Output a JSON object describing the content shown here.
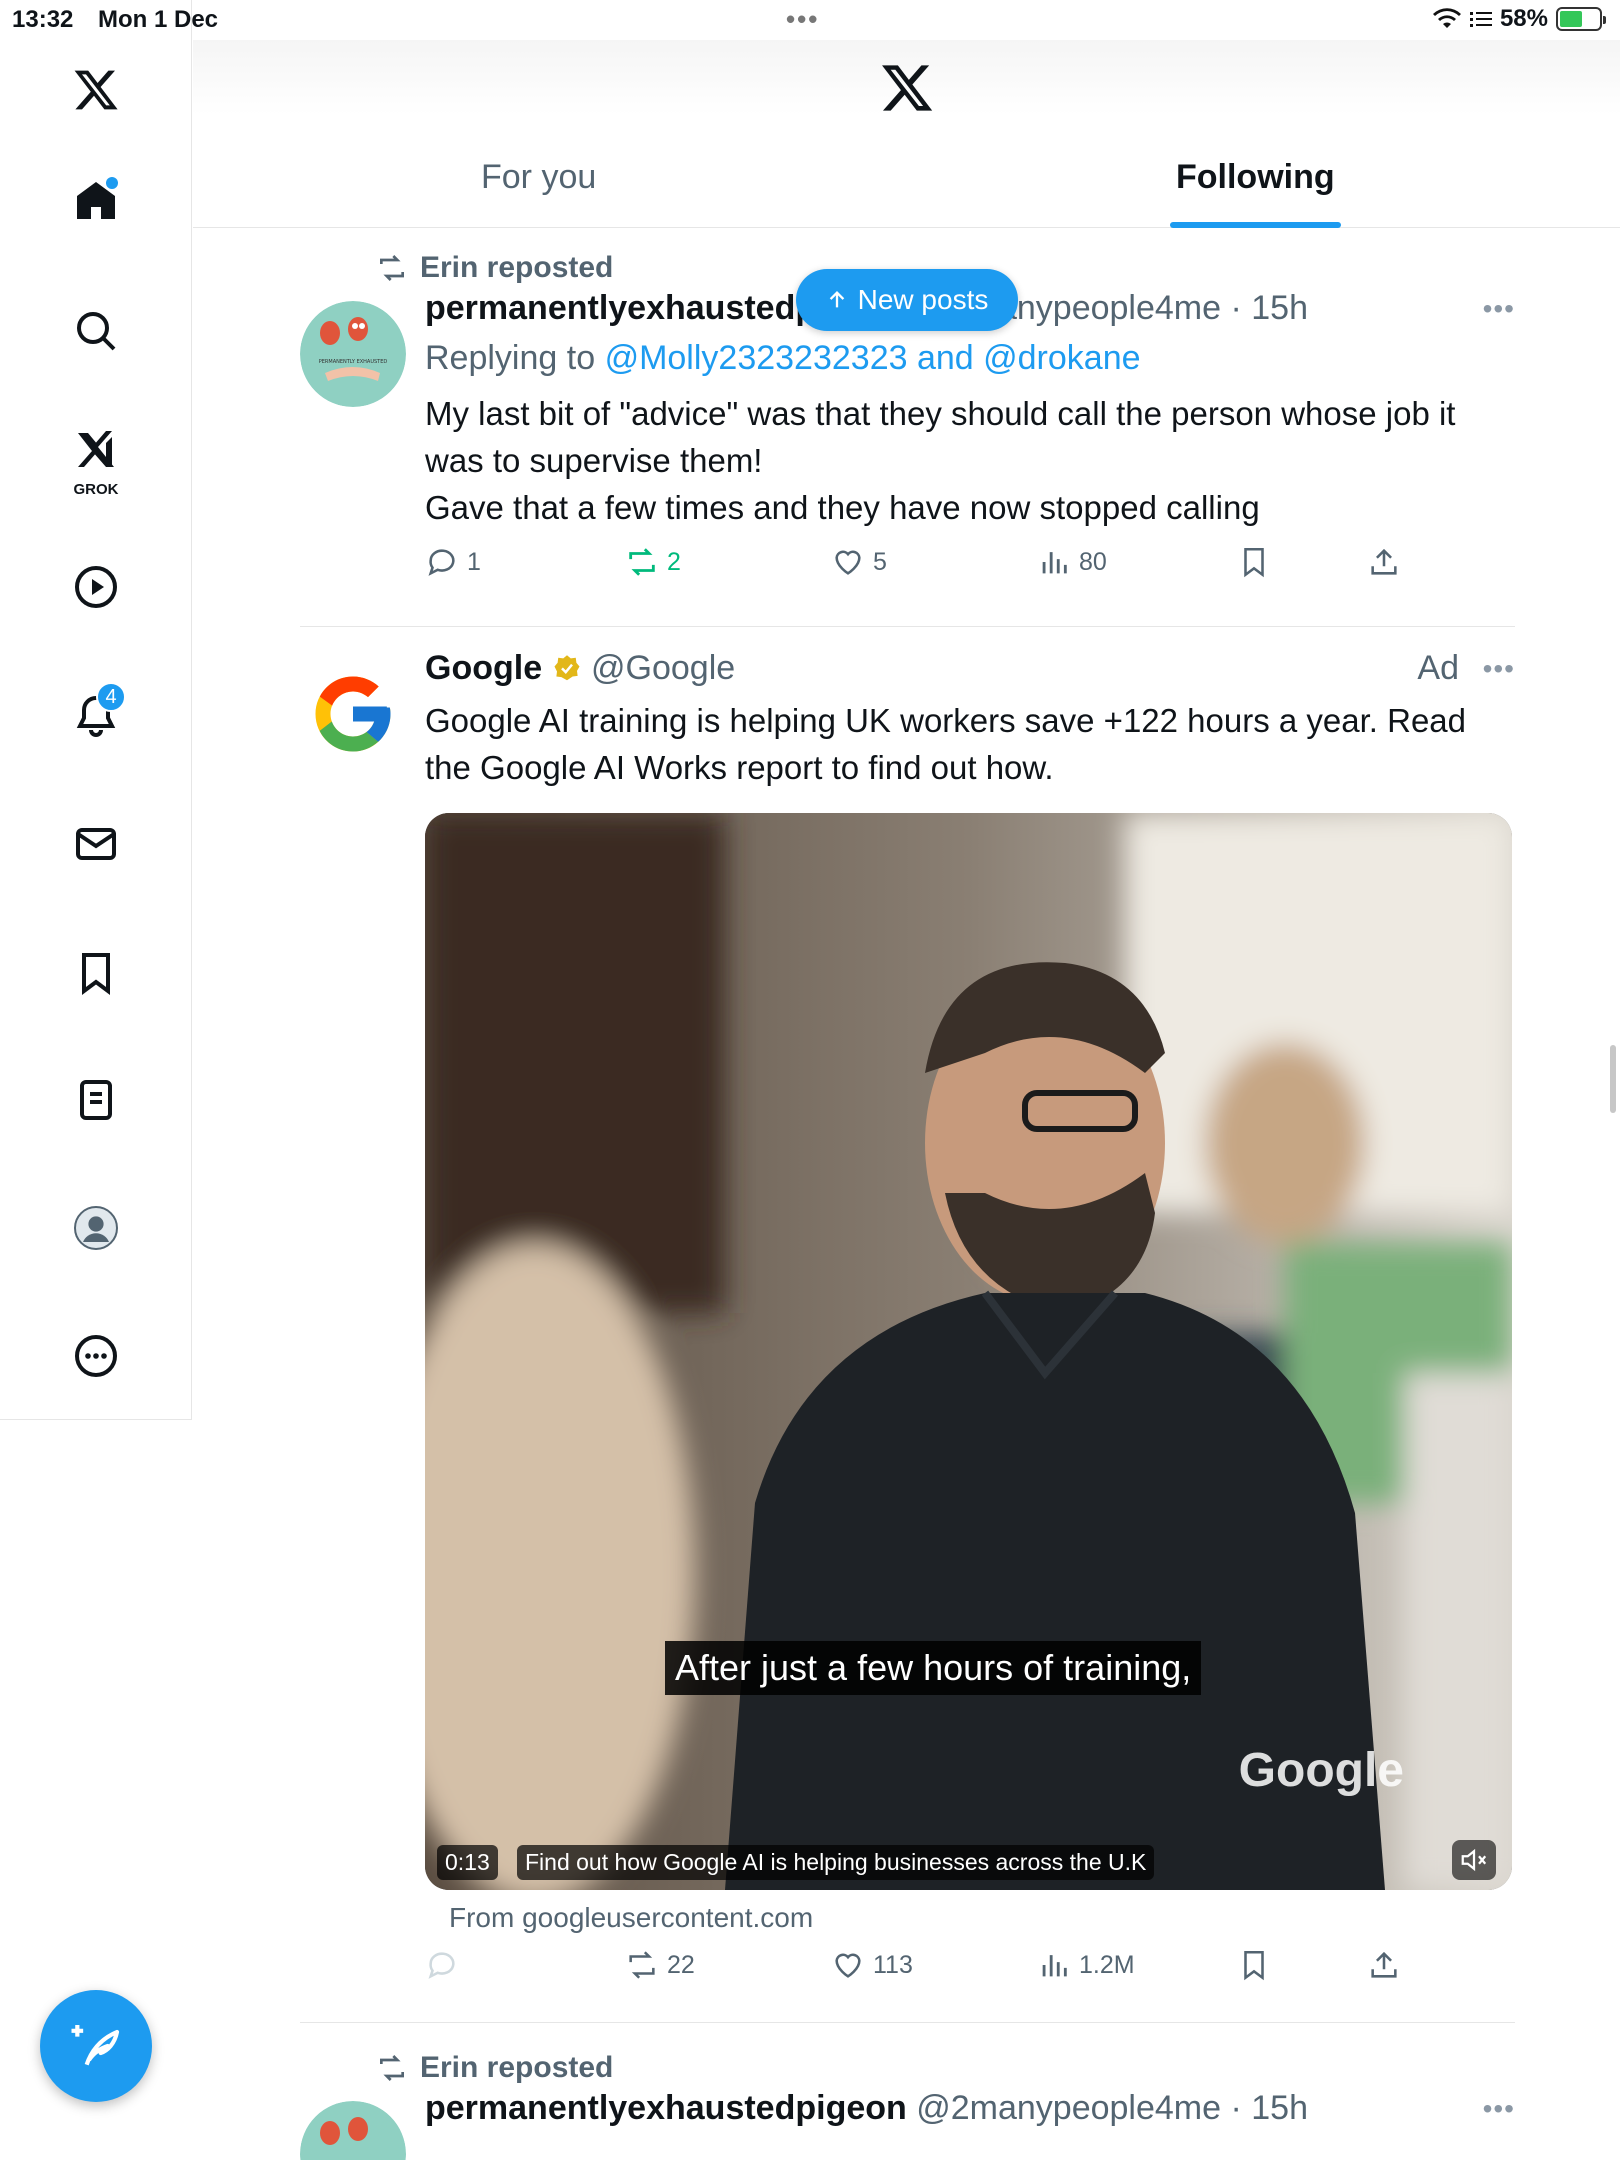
{
  "status_bar": {
    "time": "13:32",
    "date": "Mon 1 Dec",
    "battery": "58%"
  },
  "sidebar": {
    "grok_label": "GROK",
    "notifications_count": "4"
  },
  "header": {
    "tabs": [
      {
        "label": "For you",
        "selected": false
      },
      {
        "label": "Following",
        "selected": true
      }
    ]
  },
  "new_posts_label": "New posts",
  "posts": [
    {
      "repost_by": "Erin reposted",
      "display_name": "permanentlyexhaustedpigeon",
      "handle": "@2manypeople4me",
      "time": "15h",
      "replying_prefix": "Replying to",
      "replying_to": "@Molly2323232323 and @drokane",
      "text": "My last bit of \"advice\" was that they should call the person whose job it was to supervise them!\nGave that a few times and they have now stopped calling",
      "replies": "1",
      "reposts": "2",
      "likes": "5",
      "views": "80"
    },
    {
      "display_name": "Google",
      "handle": "@Google",
      "ad_label": "Ad",
      "text": "Google AI training is helping UK workers save +122 hours a year. Read the Google AI Works report to find out how.",
      "video": {
        "caption": "After just a few hours of training,",
        "watermark": "Google",
        "duration": "0:13",
        "title": "Find out how Google AI is helping businesses across the U.K"
      },
      "source": "From googleusercontent.com",
      "replies": "",
      "reposts": "22",
      "likes": "113",
      "views": "1.2M"
    },
    {
      "repost_by": "Erin reposted",
      "display_name": "permanentlyexhaustedpigeon",
      "handle": "@2manypeople4me",
      "time": "15h"
    }
  ],
  "colors": {
    "accent": "#1d9bf0",
    "repost_active": "#00ba7c",
    "secondary_text": "#536471"
  }
}
